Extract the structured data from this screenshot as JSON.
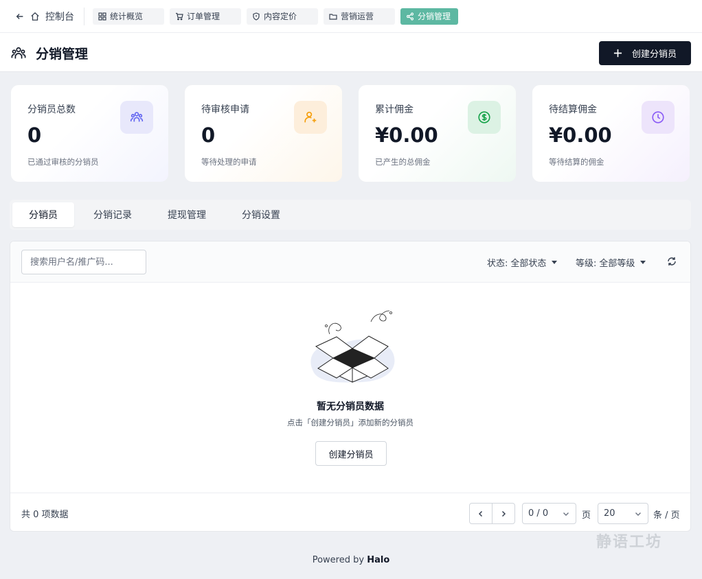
{
  "topnav": {
    "back_label": "控制台",
    "tabs": [
      {
        "label": "统计概览",
        "icon": "grid-icon"
      },
      {
        "label": "订单管理",
        "icon": "cart-icon"
      },
      {
        "label": "内容定价",
        "icon": "shield-icon"
      },
      {
        "label": "营销运营",
        "icon": "folder-icon"
      },
      {
        "label": "分销管理",
        "icon": "share-icon",
        "active": true
      }
    ]
  },
  "header": {
    "title": "分销管理",
    "create_label": "创建分销员"
  },
  "stats": [
    {
      "label": "分销员总数",
      "value": "0",
      "desc": "已通过审核的分销员",
      "icon": "users-icon",
      "color": "#6366f1"
    },
    {
      "label": "待审核申请",
      "value": "0",
      "desc": "等待处理的申请",
      "icon": "user-plus-icon",
      "color": "#f59e0b"
    },
    {
      "label": "累计佣金",
      "value": "¥0.00",
      "desc": "已产生的总佣金",
      "icon": "dollar-icon",
      "color": "#16a34a"
    },
    {
      "label": "待结算佣金",
      "value": "¥0.00",
      "desc": "等待结算的佣金",
      "icon": "clock-icon",
      "color": "#8b5cf6"
    }
  ],
  "tabs": [
    "分销员",
    "分销记录",
    "提现管理",
    "分销设置"
  ],
  "toolbar": {
    "search_placeholder": "搜索用户名/推广码...",
    "status_label": "状态:",
    "status_value": "全部状态",
    "level_label": "等级:",
    "level_value": "全部等级"
  },
  "empty": {
    "title": "暂无分销员数据",
    "subtitle": "点击「创建分销员」添加新的分销员",
    "button": "创建分销员"
  },
  "pagination": {
    "total": "共 0 项数据",
    "page_value": "0 / 0",
    "page_unit": "页",
    "size_value": "20",
    "size_unit": "条 / 页"
  },
  "footer": {
    "powered_prefix": "Powered by",
    "powered_brand": "Halo"
  },
  "watermark": "静语工坊"
}
